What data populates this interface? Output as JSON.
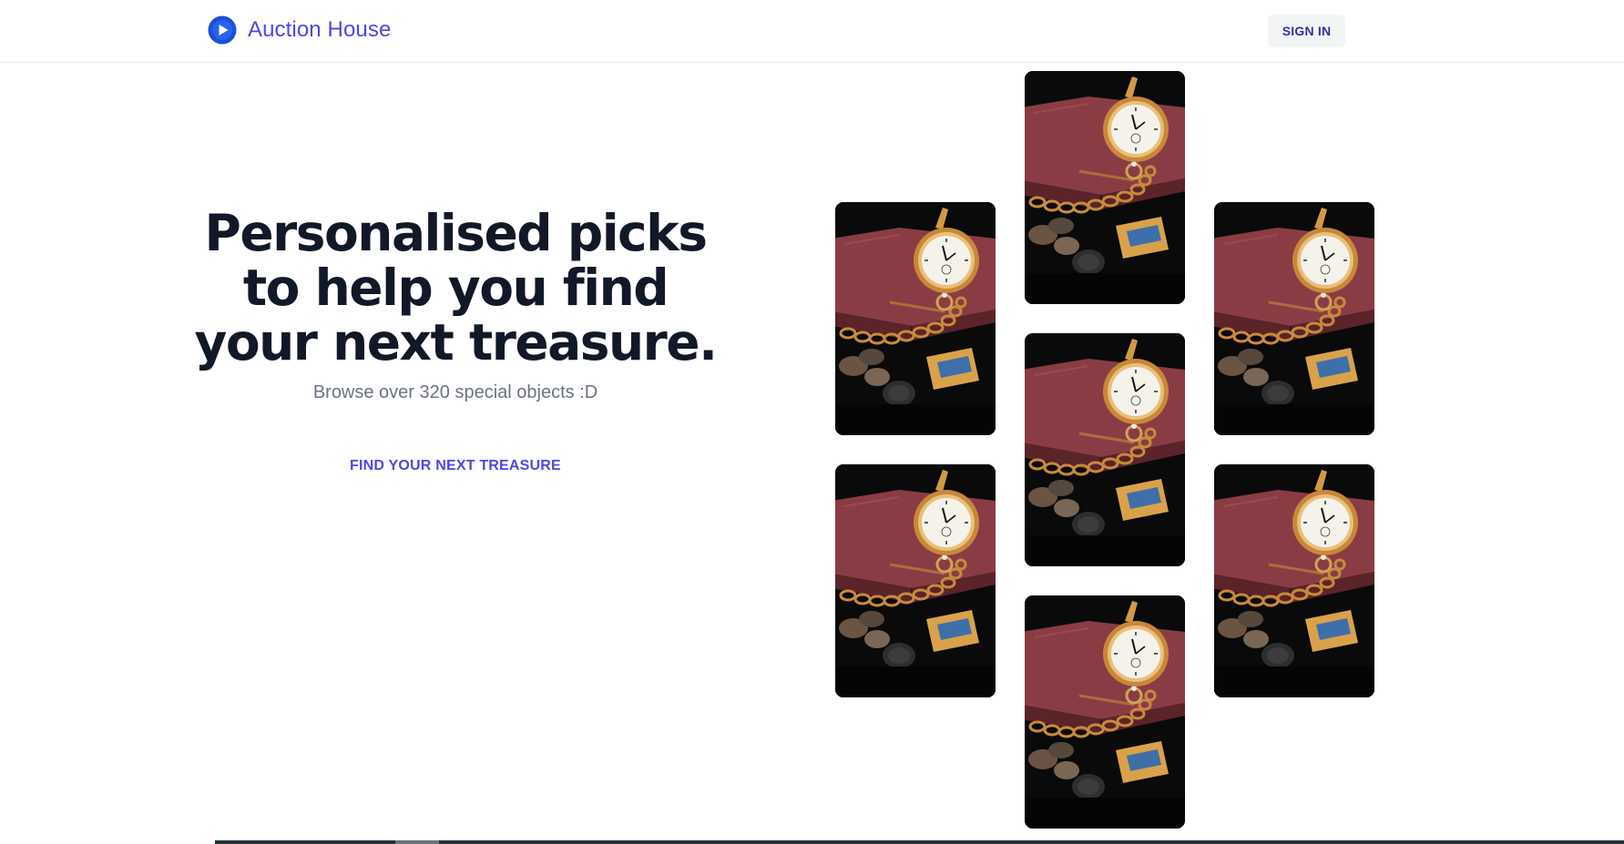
{
  "header": {
    "brand_name": "Auction House",
    "sign_in_label": "SIGN IN"
  },
  "hero": {
    "title_lines": [
      "Personalised picks",
      "to help you find",
      "your next treasure."
    ],
    "subtitle": "Browse over 320 special objects :D",
    "cta_label": "FIND YOUR NEXT TREASURE"
  },
  "colors": {
    "brand": "#4f46e5",
    "title": "#111827",
    "subtitle": "#6b7280"
  },
  "gallery": {
    "image_subject": "pocket-watch-antiques",
    "count": 7
  }
}
